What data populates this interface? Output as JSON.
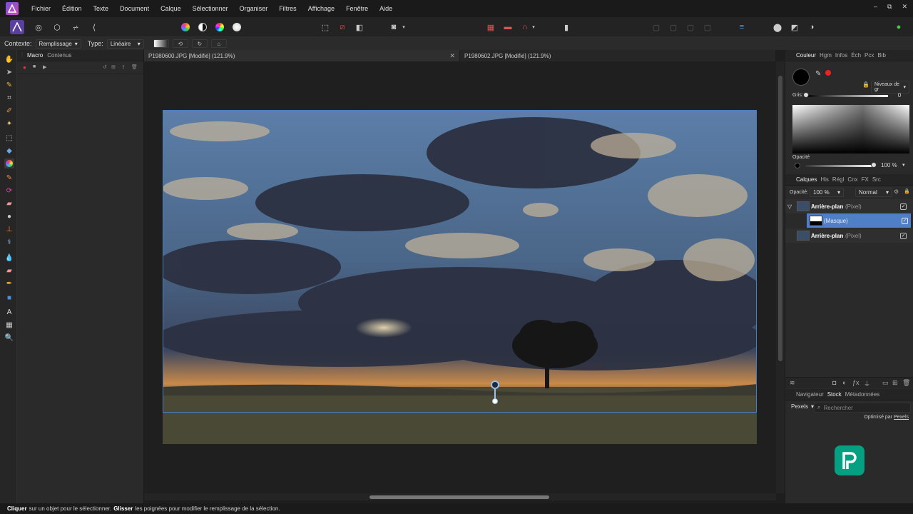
{
  "menu": {
    "logo_icon": "affinity-photo-logo-icon",
    "items": [
      "Fichier",
      "Édition",
      "Texte",
      "Document",
      "Calque",
      "Sélectionner",
      "Organiser",
      "Filtres",
      "Affichage",
      "Fenêtre",
      "Aide"
    ]
  },
  "context": {
    "label": "Contexte:",
    "mode": "Remplissage",
    "type_label": "Type:",
    "type_value": "Linéaire"
  },
  "left_panel": {
    "tabs": [
      "Macro",
      "Contenus"
    ]
  },
  "documents": {
    "tabs": [
      {
        "label": "P1980600.JPG [Modifié] (121.9%)",
        "close": "✕"
      },
      {
        "label": "P1980602.JPG [Modifié] (121.9%)"
      }
    ]
  },
  "color_panel": {
    "tabs": [
      "Couleur",
      "Hgm",
      "Infos",
      "Éch",
      "Pcx",
      "Bib"
    ],
    "mode": "Niveaux de gr",
    "gray_label": "Gris:",
    "gray_value": "0",
    "opacity_label": "Opacité",
    "opacity_value": "100 %"
  },
  "layers_panel": {
    "tabs": [
      "Calques",
      "His",
      "Régl",
      "Cnx",
      "FX",
      "Src"
    ],
    "opacity_label": "Opacité:",
    "opacity_value": "100 %",
    "blend_mode": "Normal",
    "layers": [
      {
        "name": "Arrière-plan",
        "kind": "(Pixel)"
      },
      {
        "name": "",
        "kind": "(Masque)"
      },
      {
        "name": "Arrière-plan",
        "kind": "(Pixel)"
      }
    ]
  },
  "stock_panel": {
    "tabs": [
      "Navigateur",
      "Stock",
      "Métadonnées"
    ],
    "source": "Pexels",
    "search_placeholder": "Rechercher",
    "credit": "Optimisé par",
    "credit_link": "Pexels"
  },
  "status": {
    "click_word": "Cliquer",
    "click_text": "sur un objet pour le sélectionner.",
    "drag_word": "Glisser",
    "drag_text": "les poignées pour modifier le remplissage de la sélection."
  },
  "colors": {
    "accent": "#4a7ec2",
    "selected_layer": "#4f7fc7",
    "pexels_brand": "#05a081"
  }
}
